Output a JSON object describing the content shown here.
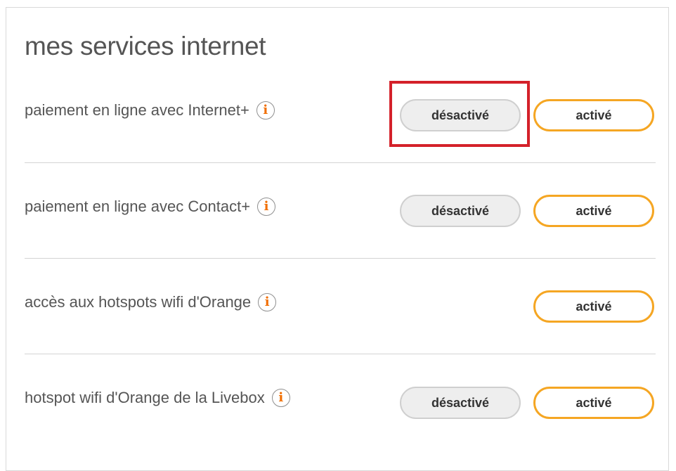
{
  "section": {
    "title": "mes services internet"
  },
  "services": [
    {
      "label": "paiement en ligne avec Internet+",
      "off_label": "désactivé",
      "on_label": "activé"
    },
    {
      "label": "paiement en ligne avec Contact+",
      "off_label": "désactivé",
      "on_label": "activé"
    },
    {
      "label": "accès aux hotspots wifi d'Orange",
      "on_label": "activé"
    },
    {
      "label": "hotspot wifi d'Orange de la Livebox",
      "off_label": "désactivé",
      "on_label": "activé"
    }
  ],
  "info_icon": {
    "name": "info-icon",
    "glyph": "i",
    "color": "#f16e00"
  },
  "colors": {
    "accent_orange": "#f5a623",
    "highlight_red": "#d4212a",
    "text_gray": "#555555"
  }
}
